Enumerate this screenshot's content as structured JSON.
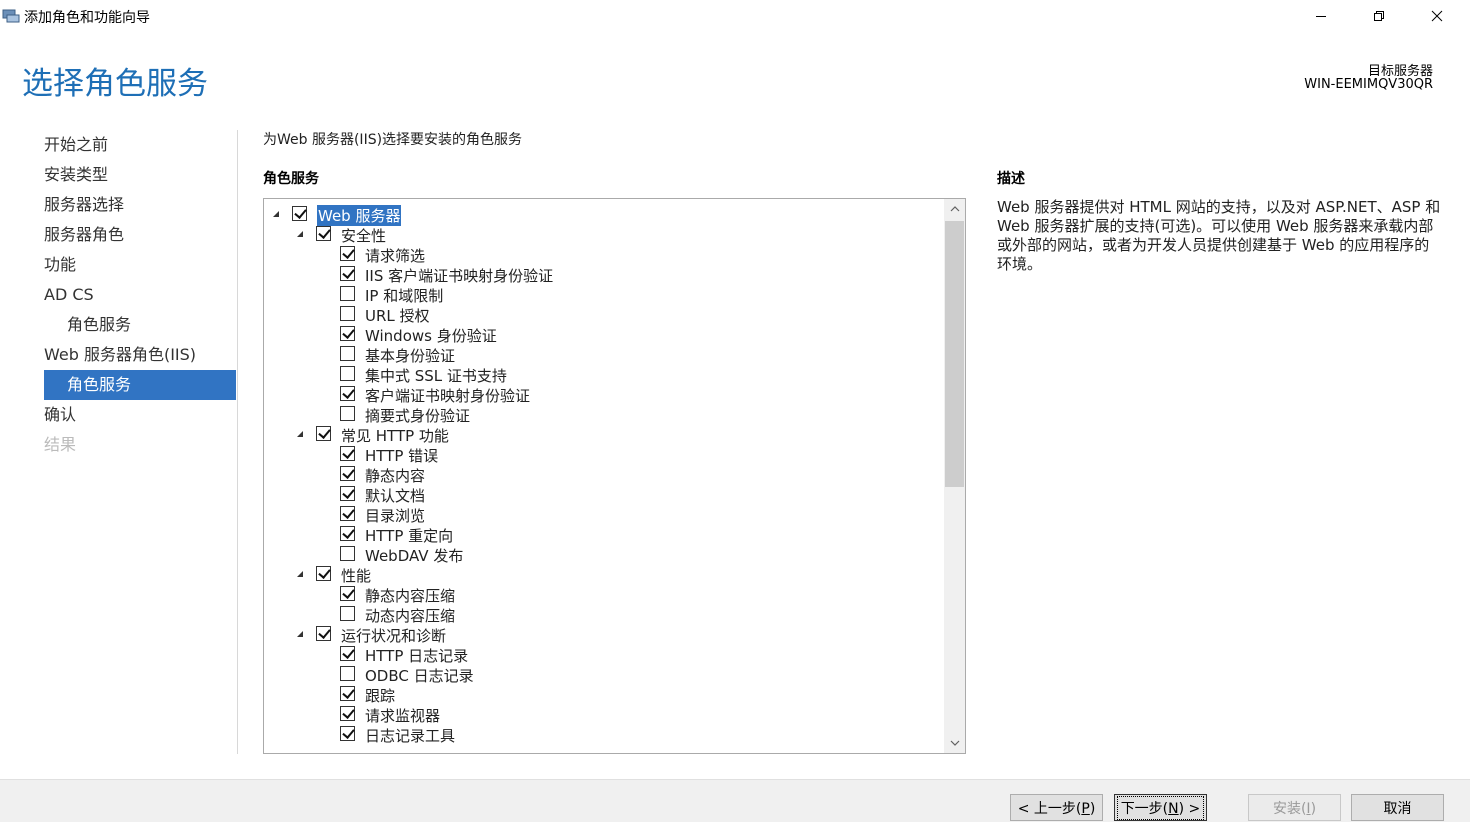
{
  "window": {
    "title": "添加角色和功能向导"
  },
  "header": {
    "page_title": "选择角色服务",
    "dest_label": "目标服务器",
    "dest_value": "WIN-EEMIMQV30QR"
  },
  "nav": {
    "items": [
      {
        "label": "开始之前",
        "state": "normal"
      },
      {
        "label": "安装类型",
        "state": "normal"
      },
      {
        "label": "服务器选择",
        "state": "normal"
      },
      {
        "label": "服务器角色",
        "state": "normal"
      },
      {
        "label": "功能",
        "state": "normal"
      },
      {
        "label": "AD CS",
        "state": "normal"
      },
      {
        "label": "角色服务",
        "state": "sub"
      },
      {
        "label": "Web 服务器角色(IIS)",
        "state": "normal"
      },
      {
        "label": "角色服务",
        "state": "active"
      },
      {
        "label": "确认",
        "state": "normal"
      },
      {
        "label": "结果",
        "state": "disabled"
      }
    ]
  },
  "main": {
    "instruction": "为Web 服务器(IIS)选择要安装的角色服务",
    "role_services_heading": "角色服务",
    "description_heading": "描述",
    "description_text": "Web 服务器提供对 HTML 网站的支持，以及对 ASP.NET、ASP 和 Web 服务器扩展的支持(可选)。可以使用 Web 服务器来承载内部或外部的网站，或者为开发人员提供创建基于 Web 的应用程序的环境。"
  },
  "tree": [
    {
      "label": "Web 服务器",
      "level": 0,
      "checked": true,
      "expandable": true,
      "selected": true
    },
    {
      "label": "安全性",
      "level": 1,
      "checked": true,
      "expandable": true
    },
    {
      "label": "请求筛选",
      "level": 2,
      "checked": true
    },
    {
      "label": "IIS 客户端证书映射身份验证",
      "level": 2,
      "checked": true
    },
    {
      "label": "IP 和域限制",
      "level": 2,
      "checked": false
    },
    {
      "label": "URL 授权",
      "level": 2,
      "checked": false
    },
    {
      "label": "Windows 身份验证",
      "level": 2,
      "checked": true
    },
    {
      "label": "基本身份验证",
      "level": 2,
      "checked": false
    },
    {
      "label": "集中式 SSL 证书支持",
      "level": 2,
      "checked": false
    },
    {
      "label": "客户端证书映射身份验证",
      "level": 2,
      "checked": true
    },
    {
      "label": "摘要式身份验证",
      "level": 2,
      "checked": false
    },
    {
      "label": "常见 HTTP 功能",
      "level": 1,
      "checked": true,
      "expandable": true
    },
    {
      "label": "HTTP 错误",
      "level": 2,
      "checked": true
    },
    {
      "label": "静态内容",
      "level": 2,
      "checked": true
    },
    {
      "label": "默认文档",
      "level": 2,
      "checked": true
    },
    {
      "label": "目录浏览",
      "level": 2,
      "checked": true
    },
    {
      "label": "HTTP 重定向",
      "level": 2,
      "checked": true
    },
    {
      "label": "WebDAV 发布",
      "level": 2,
      "checked": false
    },
    {
      "label": "性能",
      "level": 1,
      "checked": true,
      "expandable": true
    },
    {
      "label": "静态内容压缩",
      "level": 2,
      "checked": true
    },
    {
      "label": "动态内容压缩",
      "level": 2,
      "checked": false
    },
    {
      "label": "运行状况和诊断",
      "level": 1,
      "checked": true,
      "expandable": true
    },
    {
      "label": "HTTP 日志记录",
      "level": 2,
      "checked": true
    },
    {
      "label": "ODBC 日志记录",
      "level": 2,
      "checked": false
    },
    {
      "label": "跟踪",
      "level": 2,
      "checked": true
    },
    {
      "label": "请求监视器",
      "level": 2,
      "checked": true
    },
    {
      "label": "日志记录工具",
      "level": 2,
      "checked": true
    }
  ],
  "footer": {
    "prev_pre": "< 上一步(",
    "prev_key": "P",
    "prev_post": ")",
    "next_pre": "下一步(",
    "next_key": "N",
    "next_post": ") >",
    "install_pre": "安装(",
    "install_key": "I",
    "install_post": ")",
    "cancel": "取消"
  }
}
